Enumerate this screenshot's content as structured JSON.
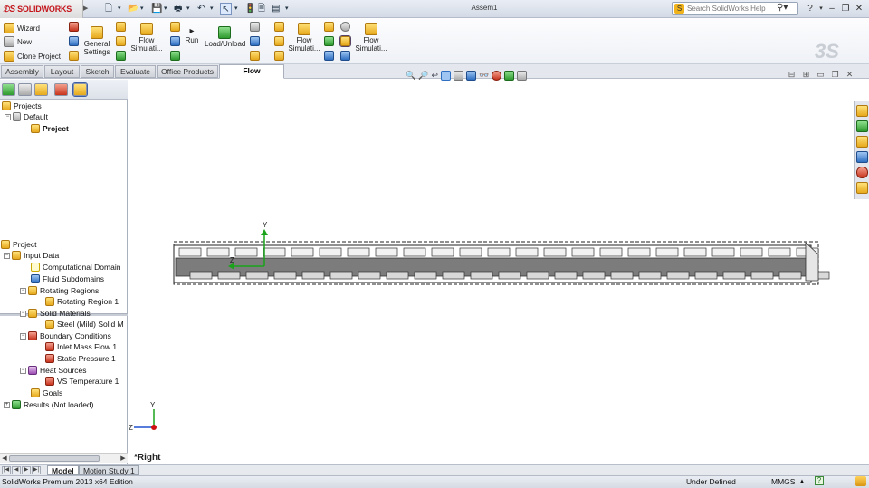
{
  "app": {
    "logo_text": "SOLIDWORKS",
    "document_title": "Assem1",
    "search_placeholder": "Search SolidWorks Help",
    "help_glyph": "?",
    "window_controls": [
      "minimize",
      "restore",
      "close"
    ]
  },
  "quick_access": {
    "icons": [
      "new-icon",
      "open-icon",
      "save-icon",
      "print-icon",
      "undo-icon",
      "select-icon",
      "rebuild-icon",
      "file-properties-icon",
      "options-icon"
    ]
  },
  "command_manager": {
    "wizard": "Wizard",
    "new": "New",
    "clone_project": "Clone Project",
    "general_settings_line1": "General",
    "general_settings_line2": "Settings",
    "flow_simulation_a_line1": "Flow",
    "flow_simulation_a_line2": "Simulati...",
    "run": "Run",
    "load_unload": "Load/Unload",
    "flow_simulation_b_line1": "Flow",
    "flow_simulation_b_line2": "Simulati...",
    "flow_simulation_c_line1": "Flow",
    "flow_simulation_c_line2": "Simulati..."
  },
  "tabs": [
    {
      "label": "Assembly"
    },
    {
      "label": "Layout"
    },
    {
      "label": "Sketch"
    },
    {
      "label": "Evaluate"
    },
    {
      "label": "Office Products"
    },
    {
      "label": "Flow Simulation"
    }
  ],
  "active_tab": "Flow Simulation",
  "top_tree": {
    "projects": "Projects",
    "default": "Default",
    "project": "Project"
  },
  "analysis_tree": {
    "project": "Project",
    "input_data": "Input Data",
    "computational_domain": "Computational Domain",
    "fluid_subdomains": "Fluid Subdomains",
    "rotating_regions": "Rotating Regions",
    "rotating_region_1": "Rotating Region 1",
    "solid_materials": "Solid Materials",
    "steel_mild": "Steel (Mild) Solid M",
    "boundary_conditions": "Boundary Conditions",
    "inlet_mass_flow_1": "Inlet Mass Flow 1",
    "static_pressure_1": "Static Pressure 1",
    "heat_sources": "Heat Sources",
    "vs_temperature_1": "VS Temperature 1",
    "goals": "Goals",
    "results": "Results (Not loaded)"
  },
  "graphics": {
    "view_name": "*Right",
    "axis_y": "Y",
    "axis_z": "Z",
    "triad_y": "Y",
    "triad_z": "Z",
    "heads_up_icons": [
      "zoom-to-fit-icon",
      "zoom-area-icon",
      "previous-view-icon",
      "section-view-icon",
      "view-orientation-icon",
      "display-style-icon",
      "hide-show-icon",
      "appearance-icon",
      "scene-icon",
      "view-settings-icon"
    ]
  },
  "bottom_tabs": [
    {
      "label": "Model"
    },
    {
      "label": "Motion Study 1"
    }
  ],
  "status": {
    "edition": "SolidWorks Premium 2013 x64 Edition",
    "state": "Under Defined",
    "units": "MMGS",
    "units_arrow": "▲",
    "help": "?"
  },
  "colors": {
    "accent_red": "#c4161c",
    "triad_green": "#1aa31a",
    "triad_red": "#d01010",
    "triad_blue": "#2050d0",
    "part_fill": "#7c7c7c"
  }
}
